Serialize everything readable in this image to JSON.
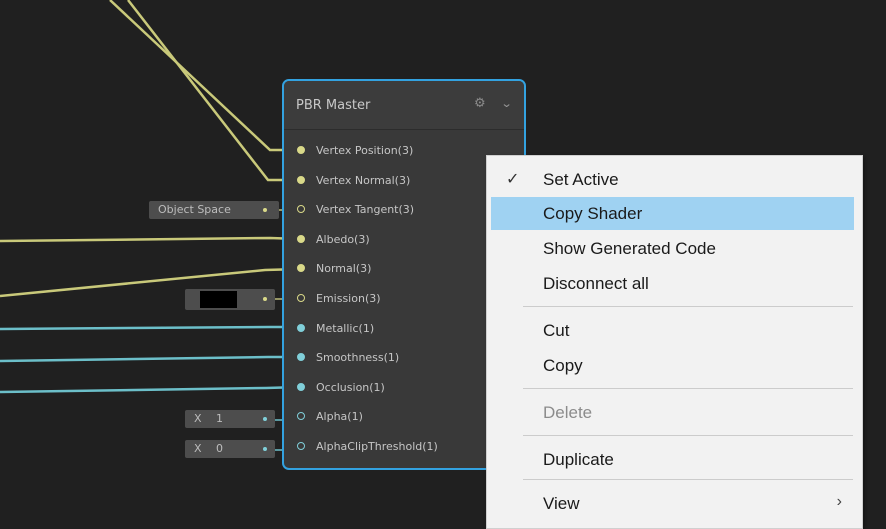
{
  "node": {
    "title": "PBR Master",
    "ports": [
      {
        "label": "Vertex Position(3)",
        "color": "#d9d989",
        "filled": true
      },
      {
        "label": "Vertex Normal(3)",
        "color": "#d9d989",
        "filled": true
      },
      {
        "label": "Vertex Tangent(3)",
        "color": "#d9d989",
        "filled": false
      },
      {
        "label": "Albedo(3)",
        "color": "#d9d989",
        "filled": true
      },
      {
        "label": "Normal(3)",
        "color": "#d9d989",
        "filled": true
      },
      {
        "label": "Emission(3)",
        "color": "#d9d989",
        "filled": false
      },
      {
        "label": "Metallic(1)",
        "color": "#80cfd9",
        "filled": true
      },
      {
        "label": "Smoothness(1)",
        "color": "#80cfd9",
        "filled": true
      },
      {
        "label": "Occlusion(1)",
        "color": "#80cfd9",
        "filled": true
      },
      {
        "label": "Alpha(1)",
        "color": "#80cfd9",
        "filled": false
      },
      {
        "label": "AlphaClipThreshold(1)",
        "color": "#80cfd9",
        "filled": false
      }
    ]
  },
  "fields": {
    "space": "Object Space",
    "emission_color": "#000000",
    "alpha_axis": "X",
    "alpha_value": "1",
    "clip_axis": "X",
    "clip_value": "0"
  },
  "menu": {
    "items": [
      {
        "label": "Set Active",
        "checked": true
      },
      {
        "label": "Copy Shader",
        "highlighted": true
      },
      {
        "label": "Show Generated Code"
      },
      {
        "label": "Disconnect all"
      },
      {
        "label": "Cut"
      },
      {
        "label": "Copy"
      },
      {
        "label": "Delete",
        "disabled": true
      },
      {
        "label": "Duplicate"
      },
      {
        "label": "View",
        "submenu": true
      }
    ],
    "check_glyph": "✓",
    "submenu_glyph": "›"
  },
  "colors": {
    "vector_wire": "#c9c97a",
    "float_wire": "#6cbfc9",
    "selection_border": "#33a2e0",
    "menu_highlight": "#9fd2f2"
  },
  "icons": {
    "settings": "gear-icon",
    "collapse": "chevron-down-icon"
  }
}
